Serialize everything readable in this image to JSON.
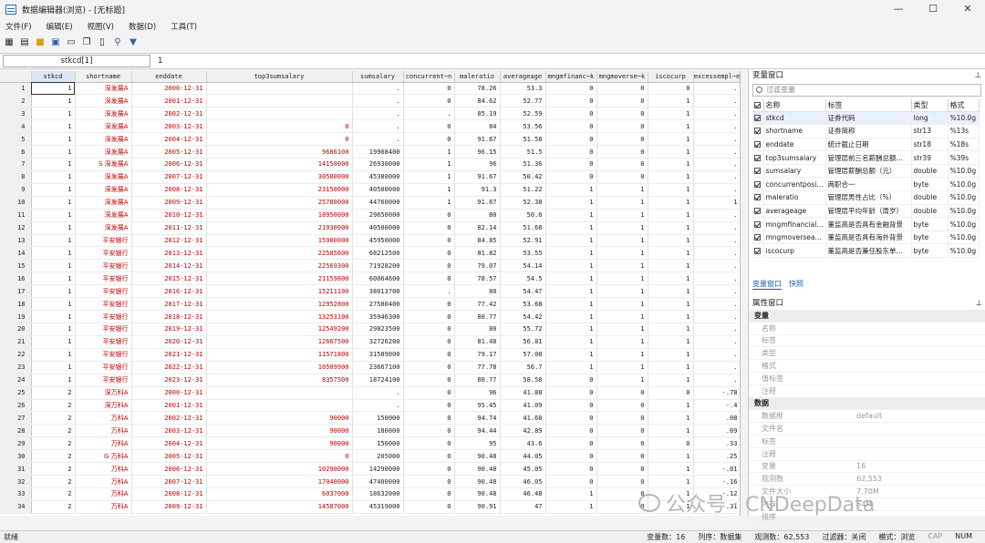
{
  "window": {
    "title": "数据编辑器(浏览) - [无标题]",
    "min": "—",
    "max": "☐",
    "close": "✕"
  },
  "menu": [
    "文件(F)",
    "编辑(E)",
    "视图(V)",
    "数据(D)",
    "工具(T)"
  ],
  "cellbar": {
    "name": "stkcd[1]",
    "value": "1"
  },
  "columns": [
    "stkcd",
    "shortname",
    "enddate",
    "top3sumsalary",
    "sumsalary",
    "concurrent~n",
    "maleratio",
    "averageage",
    "mngmfinanc~k",
    "mngmoverse~k",
    "iscocurp",
    "excessempl~e"
  ],
  "rows": [
    [
      "1",
      "1",
      "深发展A",
      "2000-12-31",
      "",
      ".",
      "0",
      "78.26",
      "53.3",
      "0",
      "0",
      "0",
      "."
    ],
    [
      "2",
      "1",
      "深发展A",
      "2001-12-31",
      "",
      ".",
      "0",
      "84.62",
      "52.77",
      "0",
      "0",
      "1",
      "."
    ],
    [
      "3",
      "1",
      "深发展A",
      "2002-12-31",
      "",
      ".",
      ".",
      "85.19",
      "52.59",
      "0",
      "0",
      "1",
      "."
    ],
    [
      "4",
      "1",
      "深发展A",
      "2003-12-31",
      "0",
      ".",
      "0",
      "84",
      "53.56",
      "0",
      "0",
      "1",
      "."
    ],
    [
      "5",
      "1",
      "深发展A",
      "2004-12-31",
      "0",
      ".",
      "0",
      "91.67",
      "51.58",
      "0",
      "0",
      "1",
      "."
    ],
    [
      "6",
      "1",
      "深发展A",
      "2005-12-31",
      "9686100",
      "19908400",
      "1",
      "96.15",
      "51.5",
      "0",
      "0",
      "1",
      "."
    ],
    [
      "7",
      "1",
      "S 深发展A",
      "2006-12-31",
      "14150000",
      "26930000",
      "1",
      "96",
      "51.36",
      "0",
      "0",
      "1",
      "."
    ],
    [
      "8",
      "1",
      "深发展A",
      "2007-12-31",
      "30580000",
      "45380000",
      "1",
      "91.67",
      "50.42",
      "0",
      "0",
      "1",
      "."
    ],
    [
      "9",
      "1",
      "深发展A",
      "2008-12-31",
      "23150000",
      "40500000",
      "1",
      "91.3",
      "51.22",
      "1",
      "1",
      "1",
      "."
    ],
    [
      "10",
      "1",
      "深发展A",
      "2009-12-31",
      "25780000",
      "44760000",
      "1",
      "91.67",
      "52.38",
      "1",
      "1",
      "1",
      "1"
    ],
    [
      "11",
      "1",
      "深发展A",
      "2010-12-31",
      "18950000",
      "29650000",
      "0",
      "80",
      "50.6",
      "1",
      "1",
      "1",
      "."
    ],
    [
      "12",
      "1",
      "深发展A",
      "2011-12-31",
      "21930000",
      "40500000",
      "0",
      "82.14",
      "51.68",
      "1",
      "1",
      "1",
      "."
    ],
    [
      "13",
      "1",
      "平安银行",
      "2012-12-31",
      "15980000",
      "45950000",
      "0",
      "84.85",
      "52.91",
      "1",
      "1",
      "1",
      "."
    ],
    [
      "14",
      "1",
      "平安银行",
      "2013-12-31",
      "22585600",
      "68212500",
      "0",
      "81.82",
      "53.55",
      "1",
      "1",
      "1",
      "."
    ],
    [
      "15",
      "1",
      "平安银行",
      "2014-12-31",
      "22569300",
      "71928200",
      "0",
      "79.07",
      "54.14",
      "1",
      "1",
      "1",
      "."
    ],
    [
      "16",
      "1",
      "平安银行",
      "2015-12-31",
      "21159800",
      "60064600",
      "0",
      "78.57",
      "54.5",
      "1",
      "1",
      "1",
      "."
    ],
    [
      "17",
      "1",
      "平安银行",
      "2016-12-31",
      "15211100",
      "38013700",
      ".",
      "80",
      "54.47",
      "1",
      "1",
      "1",
      "."
    ],
    [
      "18",
      "1",
      "平安银行",
      "2017-12-31",
      "12952800",
      "27580400",
      "0",
      "77.42",
      "53.68",
      "1",
      "1",
      "1",
      "."
    ],
    [
      "19",
      "1",
      "平安银行",
      "2018-12-31",
      "13253100",
      "35946300",
      "0",
      "80.77",
      "54.42",
      "1",
      "1",
      "1",
      "."
    ],
    [
      "20",
      "1",
      "平安银行",
      "2019-12-31",
      "12549200",
      "29823500",
      "0",
      "80",
      "55.72",
      "1",
      "1",
      "1",
      "."
    ],
    [
      "21",
      "1",
      "平安银行",
      "2020-12-31",
      "12667500",
      "32726200",
      "0",
      "81.48",
      "56.81",
      "1",
      "1",
      "1",
      "."
    ],
    [
      "22",
      "1",
      "平安银行",
      "2021-12-31",
      "11571800",
      "31589000",
      "0",
      "79.17",
      "57.08",
      "1",
      "1",
      "1",
      "."
    ],
    [
      "23",
      "1",
      "平安银行",
      "2022-12-31",
      "10509900",
      "23667100",
      "0",
      "77.78",
      "56.7",
      "1",
      "1",
      "1",
      "."
    ],
    [
      "24",
      "1",
      "平安银行",
      "2023-12-31",
      "8357500",
      "18724100",
      "0",
      "80.77",
      "58.58",
      "0",
      "1",
      "1",
      "."
    ],
    [
      "25",
      "2",
      "深万科A",
      "2000-12-31",
      "",
      ".",
      "0",
      "96",
      "41.88",
      "0",
      "0",
      "0",
      "-.78"
    ],
    [
      "26",
      "2",
      "深万科A",
      "2001-12-31",
      "",
      ".",
      "0",
      "95.45",
      "41.09",
      "0",
      "0",
      "1",
      "-.4"
    ],
    [
      "27",
      "2",
      "万科A",
      "2002-12-31",
      "90000",
      "150000",
      "0",
      "94.74",
      "41.68",
      "0",
      "0",
      "1",
      ".08"
    ],
    [
      "28",
      "2",
      "万科A",
      "2003-12-31",
      "90000",
      "180000",
      "0",
      "94.44",
      "42.89",
      "0",
      "0",
      "1",
      ".09"
    ],
    [
      "29",
      "2",
      "万科A",
      "2004-12-31",
      "90000",
      "150000",
      "0",
      "95",
      "43.6",
      "0",
      "0",
      "0",
      ".33"
    ],
    [
      "30",
      "2",
      "G 万科A",
      "2005-12-31",
      "0",
      "205000",
      "0",
      "90.48",
      "44.05",
      "0",
      "0",
      "1",
      ".25"
    ],
    [
      "31",
      "2",
      "万科A",
      "2006-12-31",
      "10290000",
      "14290000",
      "0",
      "90.48",
      "45.05",
      "0",
      "0",
      "1",
      "-.01"
    ],
    [
      "32",
      "2",
      "万科A",
      "2007-12-31",
      "17040000",
      "47400000",
      "0",
      "90.48",
      "46.05",
      "0",
      "0",
      "1",
      "-.16"
    ],
    [
      "33",
      "2",
      "万科A",
      "2008-12-31",
      "6037000",
      "18632000",
      "0",
      "90.48",
      "46.48",
      "1",
      "0",
      "1",
      "-.12"
    ],
    [
      "34",
      "2",
      "万科A",
      "2009-12-31",
      "14587000",
      "45319000",
      "0",
      "90.91",
      "47",
      "1",
      "0",
      "1",
      "-.31"
    ]
  ],
  "varpanel": {
    "title": "变量窗口",
    "filter_placeholder": "过滤变量",
    "headers": [
      "名称",
      "标签",
      "类型",
      "格式"
    ],
    "vars": [
      [
        "stkcd",
        "证券代码",
        "long",
        "%10.0g"
      ],
      [
        "shortname",
        "证券简称",
        "str13",
        "%13s"
      ],
      [
        "enddate",
        "统计截止日期",
        "str18",
        "%18s"
      ],
      [
        "top3sumsalary",
        "管理层前三名薪酬总额...",
        "str39",
        "%39s"
      ],
      [
        "sumsalary",
        "管理层薪酬总额（元）",
        "double",
        "%10.0g"
      ],
      [
        "concurrentposi...",
        "两职合一",
        "byte",
        "%10.0g"
      ],
      [
        "maleratio",
        "管理层男性占比（%）",
        "double",
        "%10.0g"
      ],
      [
        "averageage",
        "管理层平均年龄（周岁）",
        "double",
        "%10.0g"
      ],
      [
        "mngmfinancial...",
        "董监高是否具有金融背景",
        "byte",
        "%10.0g"
      ],
      [
        "mngmoversea...",
        "董监高是否具有海外背景",
        "byte",
        "%10.0g"
      ],
      [
        "iscocurp",
        "董监高是否兼任股东单...",
        "byte",
        "%10.0g"
      ]
    ],
    "tabs": [
      "变量窗口",
      "快照"
    ]
  },
  "propspanel": {
    "title": "属性窗口",
    "sections": [
      {
        "name": "变量",
        "rows": [
          [
            "名称",
            ""
          ],
          [
            "标签",
            ""
          ],
          [
            "类型",
            ""
          ],
          [
            "格式",
            ""
          ],
          [
            "值标签",
            ""
          ],
          [
            "注释",
            ""
          ]
        ]
      },
      {
        "name": "数据",
        "rows": [
          [
            "数据框",
            "default"
          ],
          [
            "文件名",
            ""
          ],
          [
            "标签",
            ""
          ],
          [
            "注释",
            ""
          ],
          [
            "变量",
            "16"
          ],
          [
            "观测数",
            "62,553"
          ],
          [
            "文件大小",
            "7.70M"
          ],
          [
            "内存",
            "64M"
          ],
          [
            "排序",
            ""
          ]
        ]
      }
    ]
  },
  "status": {
    "left": "就绪",
    "vars": "变量数：16",
    "order": "列序：数据集",
    "obs": "观测数：62,553",
    "filter": "过滤器：关闭",
    "mode": "模式：浏览",
    "cap": "CAP",
    "num": "NUM"
  },
  "watermark": "公众号 · CNDeepData"
}
